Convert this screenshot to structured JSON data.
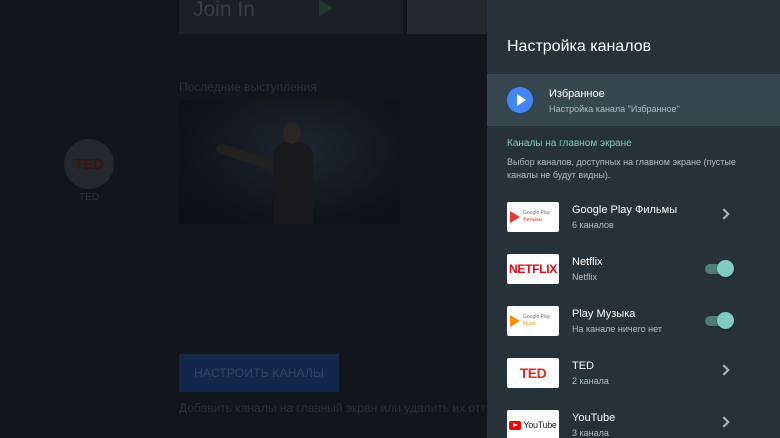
{
  "background": {
    "join_in_text": "Join In",
    "recent_title": "Последние выступления",
    "ted_channel_logo": "TED",
    "ted_channel_label": "TED",
    "configure_button_label": "НАСТРОИТЬ КАНАЛЫ",
    "configure_hint": "Добавить каналы на главный экран или удалить их оттуда"
  },
  "panel": {
    "title": "Настройка каналов",
    "favorites": {
      "title": "Избранное",
      "subtitle": "Настройка канала \"Избранное\"",
      "icon": "play-circle-icon"
    },
    "section_title": "Каналы на главном экране",
    "section_description": "Выбор каналов, доступных на главном экране (пустые каналы не будут видны).",
    "channels": [
      {
        "title": "Google Play Фильмы",
        "subtitle": "6 каналов",
        "logo": "google-play-movies-logo",
        "logo_line1": "Google Play",
        "logo_line2": "Фильмы",
        "control": "chevron"
      },
      {
        "title": "Netflix",
        "subtitle": "Netflix",
        "logo": "netflix-logo",
        "logo_text": "NETFLIX",
        "control": "toggle",
        "enabled": true
      },
      {
        "title": "Play Музыка",
        "subtitle": "На канале ничего нет",
        "logo": "google-play-music-logo",
        "logo_line1": "Google Play",
        "logo_line2": "Music",
        "control": "toggle",
        "enabled": true
      },
      {
        "title": "TED",
        "subtitle": "2 канала",
        "logo": "ted-logo",
        "logo_text": "TED",
        "control": "chevron"
      },
      {
        "title": "YouTube",
        "subtitle": "3 канала",
        "logo": "youtube-logo",
        "logo_text": "YouTube",
        "control": "chevron"
      }
    ]
  },
  "colors": {
    "panel_bg": "#263238",
    "selected_row_bg": "#37474f",
    "accent_teal": "#80cbc4",
    "favorites_blue": "#4285f4"
  }
}
